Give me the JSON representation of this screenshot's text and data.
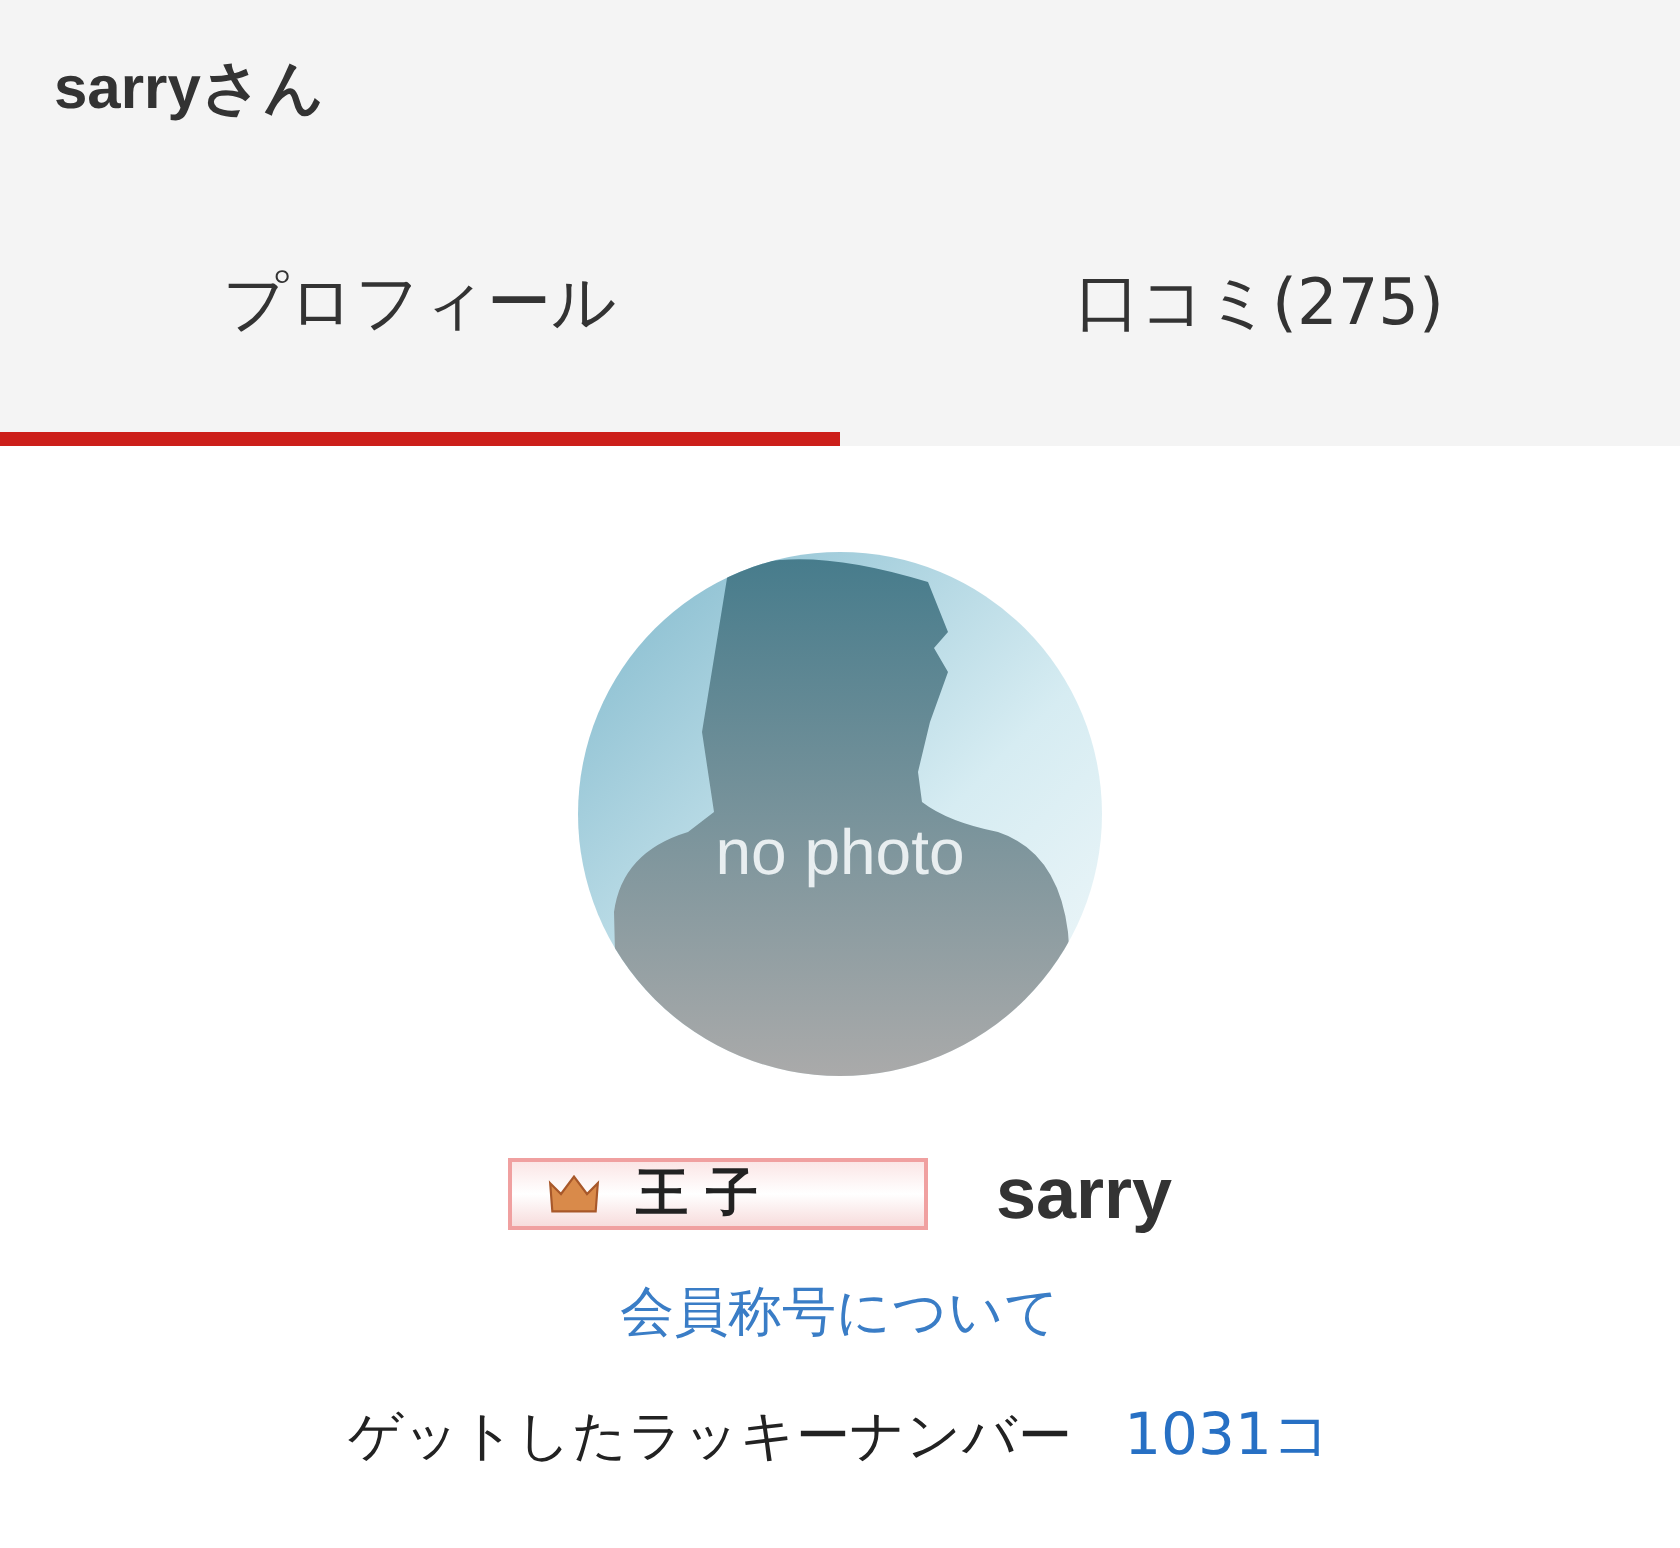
{
  "header": {
    "title": "sarryさん"
  },
  "tabs": [
    {
      "label": "プロフィール",
      "selected": true
    },
    {
      "label": "口コミ(275)",
      "selected": false
    }
  ],
  "profile": {
    "avatar_caption": "no photo",
    "badge": "王 子",
    "name": "sarry",
    "title_link": "会員称号について",
    "lucky_label": "ゲットしたラッキーナンバー",
    "lucky_count": "1031コ"
  }
}
